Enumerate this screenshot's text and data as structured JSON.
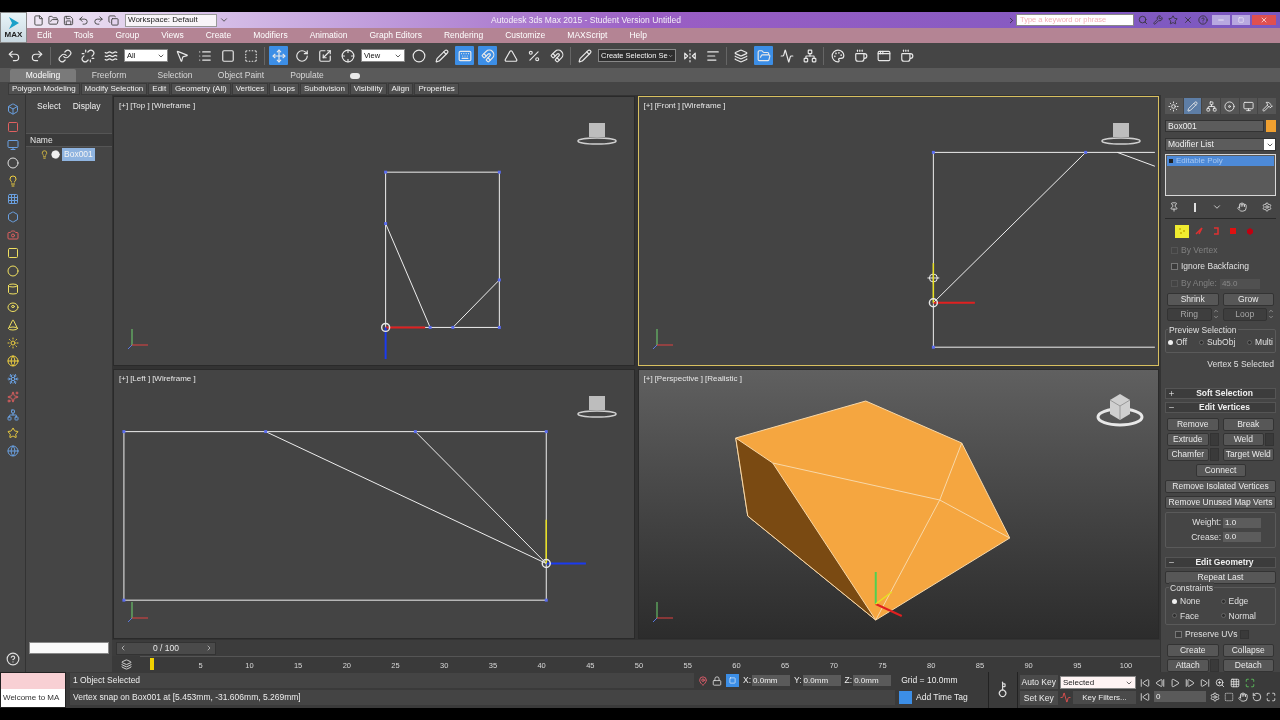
{
  "title_bar": {
    "app_label": "MAX",
    "workspace": "Workspace: Default",
    "title": "Autodesk 3ds Max  2015  - Student Version   Untitled",
    "search_placeholder": "Type a keyword or phrase"
  },
  "menu": [
    "Edit",
    "Tools",
    "Group",
    "Views",
    "Create",
    "Modifiers",
    "Animation",
    "Graph Editors",
    "Rendering",
    "Customize",
    "MAXScript",
    "Help"
  ],
  "main_toolbar": {
    "groups": [
      [
        {
          "kind": "undo",
          "selected": false
        },
        {
          "kind": "redo",
          "selected": false
        }
      ],
      [
        {
          "kind": "link",
          "selected": false
        },
        {
          "kind": "unlink",
          "selected": false
        },
        {
          "kind": "bind",
          "selected": false
        },
        {
          "kind": "dropdown",
          "value": "All"
        },
        {
          "kind": "select",
          "selected": false
        },
        {
          "kind": "select-by-name",
          "selected": false
        },
        {
          "kind": "region",
          "selected": false
        },
        {
          "kind": "crossing",
          "selected": false
        }
      ],
      [
        {
          "kind": "move",
          "selected": true
        },
        {
          "kind": "rotate",
          "selected": false
        },
        {
          "kind": "scale",
          "selected": false
        },
        {
          "kind": "place",
          "selected": false
        },
        {
          "kind": "dropdown",
          "value": "View"
        },
        {
          "kind": "pivot",
          "selected": false
        },
        {
          "kind": "manipulate",
          "selected": false
        },
        {
          "kind": "keyboard",
          "selected": true
        },
        {
          "kind": "snap",
          "selected": true
        },
        {
          "kind": "angle-snap",
          "selected": false
        },
        {
          "kind": "percent-snap",
          "selected": false
        },
        {
          "kind": "spinner-snap",
          "selected": false
        }
      ],
      [
        {
          "kind": "edit-named",
          "selected": false
        },
        {
          "kind": "dropdown",
          "value": "Create Selection Se"
        },
        {
          "kind": "mirror",
          "selected": false
        },
        {
          "kind": "align",
          "selected": false
        }
      ],
      [
        {
          "kind": "layers",
          "selected": false
        },
        {
          "kind": "explorer",
          "selected": true
        },
        {
          "kind": "curve-editor",
          "selected": false
        },
        {
          "kind": "schematic",
          "selected": false
        }
      ],
      [
        {
          "kind": "material",
          "selected": false
        },
        {
          "kind": "render-setup",
          "selected": false
        },
        {
          "kind": "frame-window",
          "selected": false
        },
        {
          "kind": "render",
          "selected": false
        }
      ]
    ]
  },
  "ribbon_tabs": [
    {
      "label": "Modeling",
      "selected": true
    },
    {
      "label": "Freeform",
      "selected": false
    },
    {
      "label": "Selection",
      "selected": false
    },
    {
      "label": "Object Paint",
      "selected": false
    },
    {
      "label": "Populate",
      "selected": false
    }
  ],
  "ribbon_panels": [
    "Polygon Modeling",
    "Modify Selection",
    "Edit",
    "Geometry (All)",
    "Vertices",
    "Loops",
    "Subdivision",
    "Visibility",
    "Align",
    "Properties"
  ],
  "scene_explorer": {
    "menus": [
      "Select",
      "Display"
    ],
    "column": "Name",
    "items": [
      {
        "name": "Box001",
        "selected": true
      }
    ]
  },
  "viewports": [
    {
      "kind": "top",
      "labels": [
        "[+]",
        "[Top ]",
        "[Wireframe ]"
      ],
      "active": false
    },
    {
      "kind": "front",
      "labels": [
        "[+]",
        "[Front ]",
        "[Wireframe ]"
      ],
      "active": true
    },
    {
      "kind": "left",
      "labels": [
        "[+]",
        "[Left ]",
        "[Wireframe ]"
      ],
      "active": false
    },
    {
      "kind": "perspective",
      "labels": [
        "[+]",
        "[Perspective ]",
        "[Realistic ]"
      ],
      "active": false
    }
  ],
  "timeline": {
    "frame": "0 / 100",
    "ticks": [
      "5",
      "10",
      "15",
      "20",
      "25",
      "30",
      "35",
      "40",
      "45",
      "50",
      "55",
      "60",
      "65",
      "70",
      "75",
      "80",
      "85",
      "90",
      "95",
      "100"
    ]
  },
  "command_panel": {
    "tabs": [
      {
        "kind": "create",
        "selected": false
      },
      {
        "kind": "modify",
        "selected": true
      },
      {
        "kind": "hierarchy",
        "selected": false
      },
      {
        "kind": "motion",
        "selected": false
      },
      {
        "kind": "display",
        "selected": false
      },
      {
        "kind": "utilities",
        "selected": false
      }
    ],
    "object_name": "Box001",
    "modifier_list": "Modifier List",
    "stack": [
      {
        "name": "Editable Poly",
        "selected": true
      }
    ],
    "subobjects": [
      {
        "kind": "vertex",
        "selected": true
      },
      {
        "kind": "edge",
        "selected": false
      },
      {
        "kind": "border",
        "selected": false
      },
      {
        "kind": "polygon",
        "selected": false
      },
      {
        "kind": "element",
        "selected": false
      }
    ],
    "by_vertex": {
      "label": "By Vertex",
      "checked": false,
      "disabled": true
    },
    "ignore_backfacing": {
      "label": "Ignore Backfacing",
      "checked": false,
      "disabled": false
    },
    "by_angle": {
      "label": "By Angle:",
      "checked": false,
      "disabled": true,
      "value": "45.0"
    },
    "grow_buttons": [
      {
        "label": "Shrink",
        "disabled": false,
        "spinner": false
      },
      {
        "label": "Grow",
        "disabled": false,
        "spinner": false
      },
      {
        "label": "Ring",
        "disabled": true,
        "spinner": true
      },
      {
        "label": "Loop",
        "disabled": true,
        "spinner": true
      }
    ],
    "preview": {
      "title": "Preview Selection",
      "options": [
        {
          "label": "Off",
          "selected": true
        },
        {
          "label": "SubObj",
          "selected": false
        },
        {
          "label": "Multi",
          "selected": false
        }
      ]
    },
    "status": "Vertex 5 Selected",
    "rollouts": [
      {
        "title": "Soft Selection",
        "expanded": false
      },
      {
        "title": "Edit Vertices",
        "expanded": true
      }
    ],
    "vertex_buttons": [
      {
        "label": "Remove",
        "settings": false
      },
      {
        "label": "Break",
        "settings": false
      },
      {
        "label": "Extrude",
        "settings": true
      },
      {
        "label": "Weld",
        "settings": true
      },
      {
        "label": "Chamfer",
        "settings": true
      },
      {
        "label": "Target Weld",
        "settings": false
      }
    ],
    "connect": "Connect",
    "wide_buttons": [
      "Remove Isolated Vertices",
      "Remove Unused Map Verts"
    ],
    "weight": {
      "label": "Weight:",
      "value": "1.0"
    },
    "crease": {
      "label": "Crease:",
      "value": "0.0"
    },
    "edit_geometry": {
      "title": "Edit Geometry",
      "expanded": true,
      "repeat": "Repeat Last",
      "constraints_title": "Constraints",
      "constraints": [
        {
          "label": "None",
          "selected": true
        },
        {
          "label": "Edge",
          "selected": false
        },
        {
          "label": "Face",
          "selected": false
        },
        {
          "label": "Normal",
          "selected": false
        }
      ],
      "preserve_uvs": {
        "label": "Preserve UVs",
        "checked": false
      },
      "buttons": [
        {
          "label": "Create",
          "settings": false
        },
        {
          "label": "Collapse",
          "settings": false
        },
        {
          "label": "Attach",
          "settings": true
        },
        {
          "label": "Detach",
          "settings": false
        }
      ]
    }
  },
  "status_bar": {
    "prompt_box": "Welcome to MA",
    "selection": "1 Object Selected",
    "prompt": "Vertex snap on Box001 at [5.453mm, -31.606mm, 5.269mm]",
    "coords": [
      {
        "label": "X:",
        "value": "0.0mm"
      },
      {
        "label": "Y:",
        "value": "0.0mm"
      },
      {
        "label": "Z:",
        "value": "0.0mm"
      }
    ],
    "grid": "Grid = 10.0mm",
    "add_time_tag": "Add Time Tag",
    "auto_key": "Auto Key",
    "set_key": "Set Key",
    "key_mode": "Selected",
    "key_filters": "Key Filters...",
    "frame": "0"
  }
}
